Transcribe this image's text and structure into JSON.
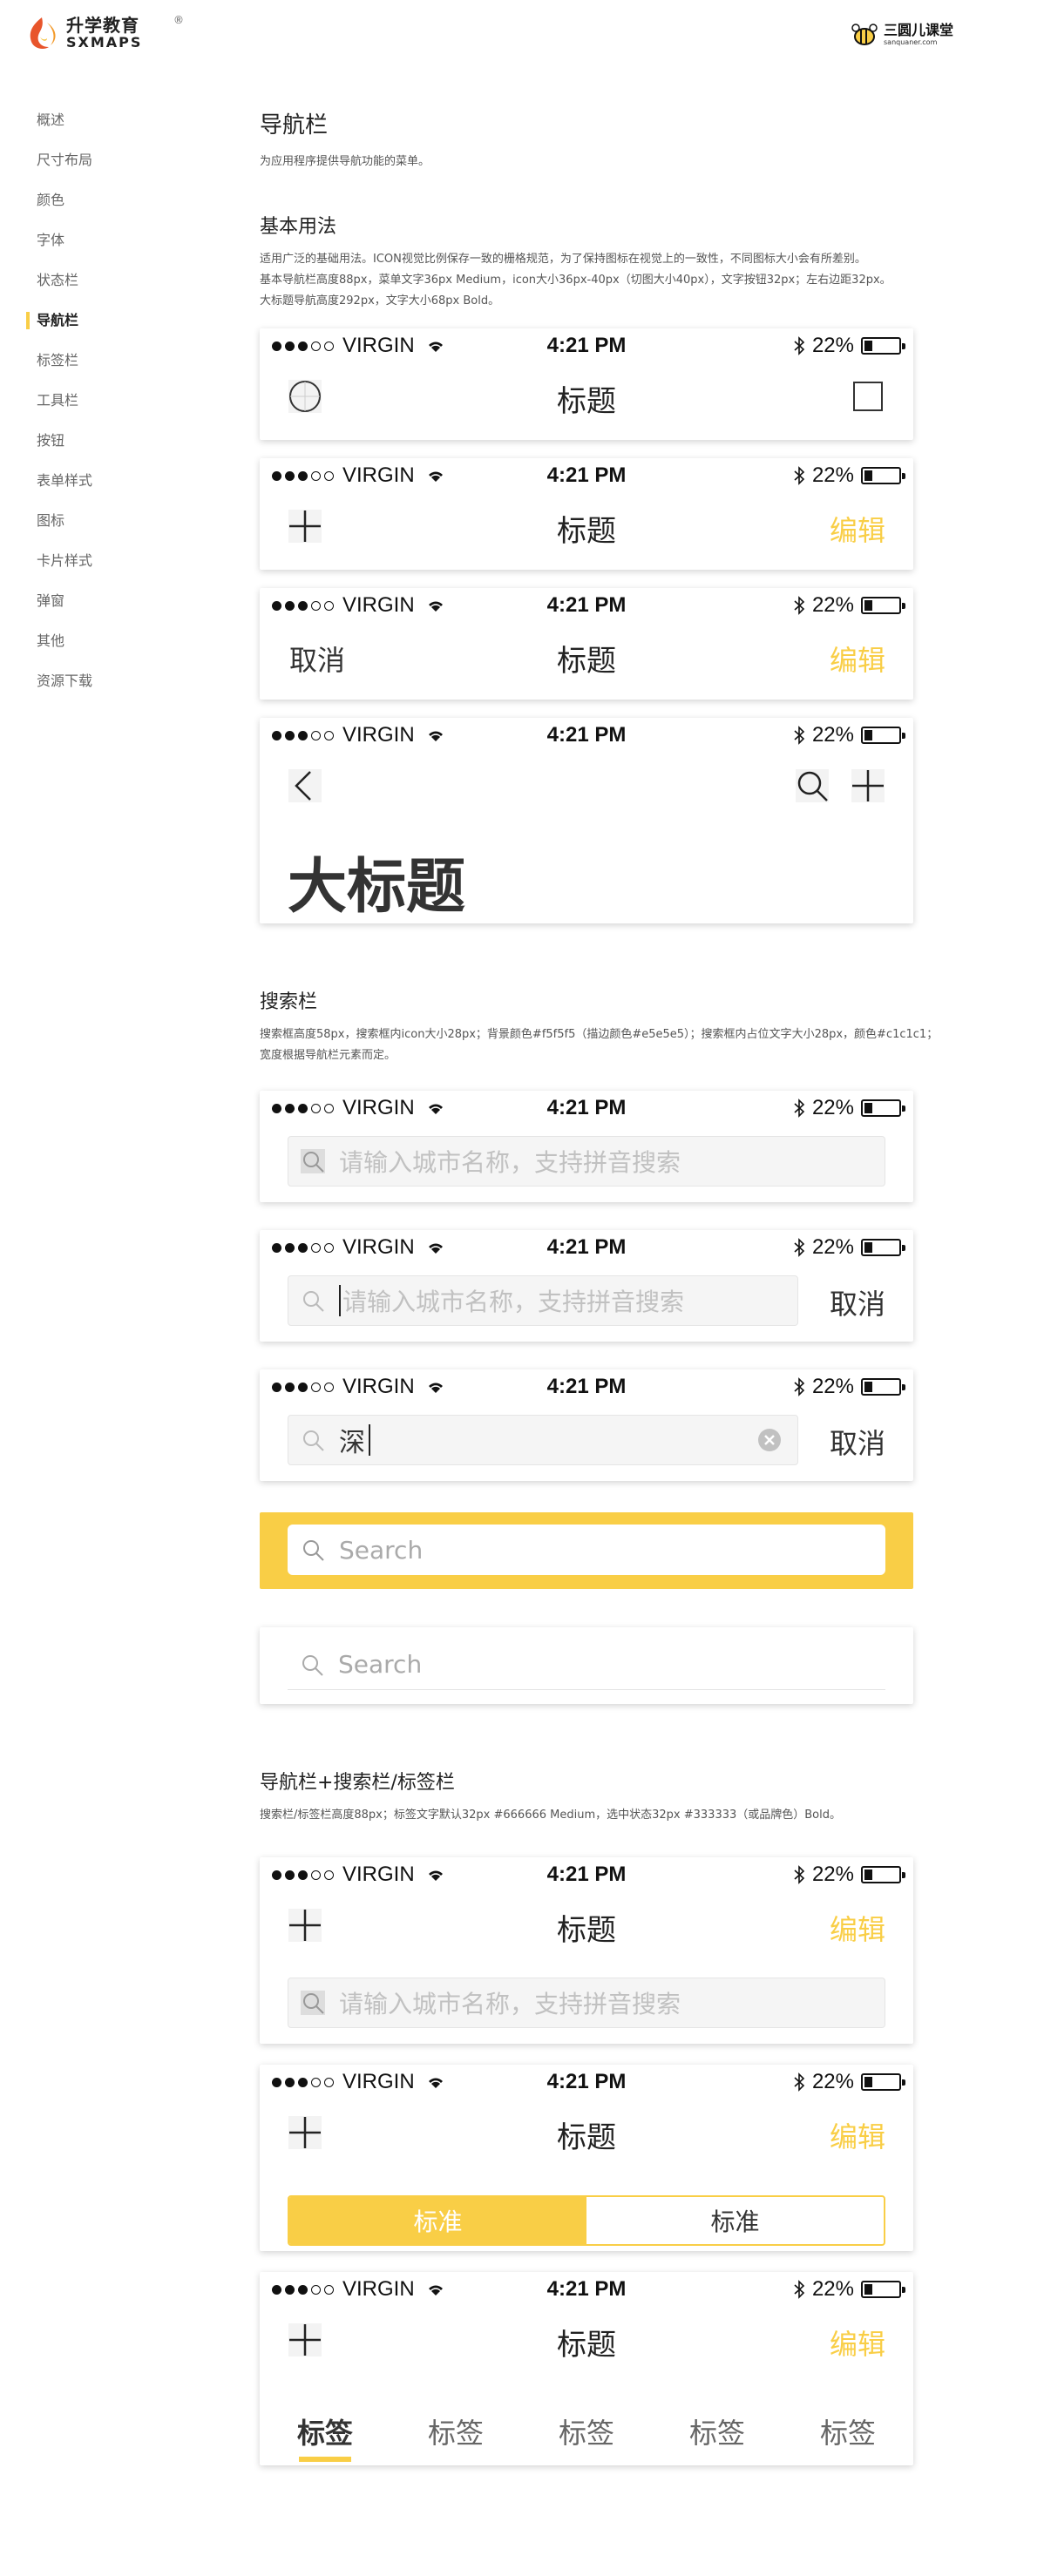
{
  "brand": {
    "cn": "升学教育",
    "en": "SXMAPS",
    "reg": "®"
  },
  "partner": {
    "cn": "三圆儿课堂",
    "en": "sanquaner.com"
  },
  "sidebar": {
    "items": [
      {
        "label": "概述"
      },
      {
        "label": "尺寸布局"
      },
      {
        "label": "颜色"
      },
      {
        "label": "字体"
      },
      {
        "label": "状态栏"
      },
      {
        "label": "导航栏"
      },
      {
        "label": "标签栏"
      },
      {
        "label": "工具栏"
      },
      {
        "label": "按钮"
      },
      {
        "label": "表单样式"
      },
      {
        "label": "图标"
      },
      {
        "label": "卡片样式"
      },
      {
        "label": "弹窗"
      },
      {
        "label": "其他"
      },
      {
        "label": "资源下载"
      }
    ],
    "active_index": 5
  },
  "page": {
    "title": "导航栏",
    "subtitle": "为应用程序提供导航功能的菜单。"
  },
  "section1": {
    "title": "基本用法",
    "desc": [
      "适用广泛的基础用法。ICON视觉比例保存一致的栅格规范，为了保持图标在视觉上的一致性，不同图标大小会有所差别。",
      "基本导航栏高度88px，菜单文字36px Medium，icon大小36px-40px（切图大小40px），文字按钮32px；左右边距32px。",
      "大标题导航高度292px，文字大小68px Bold。"
    ]
  },
  "section2": {
    "title": "搜索栏",
    "desc": [
      "搜索框高度58px，搜索框内icon大小28px；背景颜色#f5f5f5（描边颜色#e5e5e5）；搜索框内占位文字大小28px，颜色#c1c1c1；",
      "宽度根据导航栏元素而定。"
    ]
  },
  "section3": {
    "title": "导航栏+搜索栏/标签栏",
    "desc": [
      "搜索栏/标签栏高度88px；标签文字默认32px #666666 Medium，选中状态32px #333333（或品牌色）Bold。"
    ]
  },
  "status": {
    "carrier": "VIRGIN",
    "time": "4:21 PM",
    "battery": "22%"
  },
  "nav": {
    "title": "标题",
    "edit": "编辑",
    "cancel": "取消",
    "big_title": "大标题"
  },
  "search": {
    "placeholder_cn": "请输入城市名称，支持拼音搜索",
    "typed": "深",
    "placeholder_en": "Search"
  },
  "segment": {
    "left": "标准",
    "right": "标准"
  },
  "tabs": [
    "标签",
    "标签",
    "标签",
    "标签",
    "标签"
  ],
  "colors": {
    "accent": "#f9ce46",
    "search_bg": "#f5f5f5",
    "search_border": "#e5e5e5",
    "placeholder": "#c1c1c1"
  }
}
